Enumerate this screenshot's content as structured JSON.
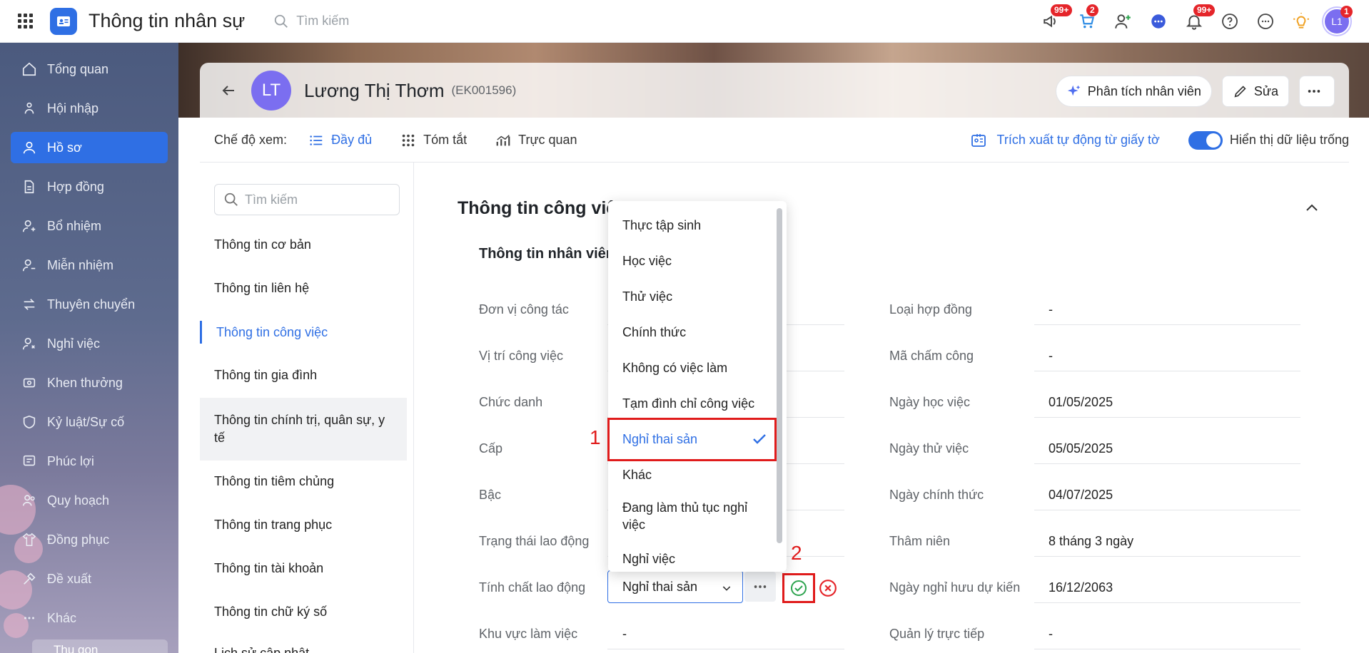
{
  "app": {
    "title": "Thông tin nhân sự",
    "search_placeholder": "Tìm kiếm"
  },
  "topbar": {
    "badges": {
      "announce": "99+",
      "cart": "2",
      "bell": "99+",
      "avatar": "1"
    },
    "avatar": "L1"
  },
  "sidebar": {
    "items": [
      {
        "label": "Tổng quan"
      },
      {
        "label": "Hội nhập"
      },
      {
        "label": "Hồ sơ"
      },
      {
        "label": "Hợp đồng"
      },
      {
        "label": "Bổ nhiệm"
      },
      {
        "label": "Miễn nhiệm"
      },
      {
        "label": "Thuyên chuyển"
      },
      {
        "label": "Nghỉ việc"
      },
      {
        "label": "Khen thưởng"
      },
      {
        "label": "Kỷ luật/Sự cố"
      },
      {
        "label": "Phúc lợi"
      },
      {
        "label": "Quy hoạch"
      },
      {
        "label": "Đồng phục"
      },
      {
        "label": "Đề xuất"
      },
      {
        "label": "Khác"
      }
    ],
    "collapse_label": "Thu gọn"
  },
  "employee": {
    "initials": "LT",
    "name": "Lương Thị Thơm",
    "code": "(EK001596)",
    "analyze_label": "Phân tích nhân viên",
    "edit_label": "Sửa"
  },
  "viewbar": {
    "label": "Chế độ xem:",
    "modes": [
      "Đầy đủ",
      "Tóm tắt",
      "Trực quan"
    ],
    "extract_label": "Trích xuất tự động từ giấy tờ",
    "toggle_label": "Hiển thị dữ liệu trống"
  },
  "secnav": {
    "search_placeholder": "Tìm kiếm",
    "items": [
      "Thông tin cơ bản",
      "Thông tin liên hệ",
      "Thông tin công việc",
      "Thông tin gia đình",
      "Thông tin chính trị, quân sự, y tế",
      "Thông tin tiêm chủng",
      "Thông tin trang phục",
      "Thông tin tài khoản",
      "Thông tin chữ ký số",
      "Lịch sử cập nhật"
    ]
  },
  "main": {
    "section_title": "Thông tin công việc",
    "sub_title": "Thông tin nhân viên",
    "left_fields": [
      {
        "label": "Đơn vị công tác"
      },
      {
        "label": "Vị trí công việc"
      },
      {
        "label": "Chức danh"
      },
      {
        "label": "Cấp"
      },
      {
        "label": "Bậc"
      },
      {
        "label": "Trạng thái lao động"
      },
      {
        "label": "Tính chất lao động"
      },
      {
        "label": "Khu vực làm việc",
        "value": "-"
      }
    ],
    "right_fields": [
      {
        "label": "Loại hợp đồng",
        "value": "-"
      },
      {
        "label": "Mã chấm công",
        "value": "-"
      },
      {
        "label": "Ngày học việc",
        "value": "01/05/2025"
      },
      {
        "label": "Ngày thử việc",
        "value": "05/05/2025"
      },
      {
        "label": "Ngày chính thức",
        "value": "04/07/2025"
      },
      {
        "label": "Thâm niên",
        "value": "8 tháng 3 ngày"
      },
      {
        "label": "Ngày nghỉ hưu dự kiến",
        "value": "16/12/2063"
      },
      {
        "label": "Quản lý trực tiếp",
        "value": "-"
      }
    ],
    "editor_value": "Nghỉ thai sản"
  },
  "dropdown": {
    "options": [
      "Thực tập sinh",
      "Học việc",
      "Thử việc",
      "Chính thức",
      "Không có việc làm",
      "Tạm đình chỉ công việc",
      "Nghỉ thai sản",
      "Khác",
      "Đang làm thủ tục nghỉ việc",
      "Nghỉ việc"
    ],
    "selected": "Nghỉ thai sản"
  },
  "annotations": {
    "one": "1",
    "two": "2"
  },
  "colors": {
    "accent": "#2f6fe4",
    "highlight": "#e01b1b"
  }
}
